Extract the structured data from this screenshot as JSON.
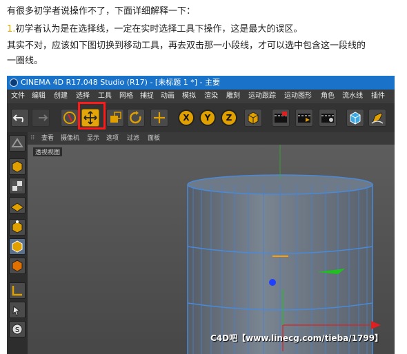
{
  "article": {
    "line1": "有很多初学者说操作不了，下面详细解释一下：",
    "line2_num": "1.",
    "line2": "初学者认为是在选择线，一定在实时选择工具下操作，这是最大的误区。",
    "line3": "其实不对，应该如下图切换到移动工具，再去双击那一小段线，才可以选中包含这一段线的",
    "line4": "一圈线。"
  },
  "app": {
    "title": "CINEMA 4D R17.048 Studio (R17) - [未标题 1 *] - 主要",
    "menu": [
      "文件",
      "编辑",
      "创建",
      "选择",
      "工具",
      "网格",
      "捕捉",
      "动画",
      "模拟",
      "渲染",
      "雕刻",
      "运动跟踪",
      "运动图形",
      "角色",
      "流水线",
      "插件"
    ],
    "axis_buttons": [
      "X",
      "Y",
      "Z"
    ],
    "viewport_menu": [
      "查看",
      "摄像机",
      "显示",
      "选项",
      "过滤",
      "面板"
    ],
    "viewport_label": "透视视图",
    "watermark": "C4D吧【www.linecg.com/tieba/1799】"
  },
  "colors": {
    "titlebar": "#1a73c8",
    "highlight": "#ff1a1a",
    "axis_x": "#e02020",
    "axis_y": "#20c020",
    "axis_z": "#2040ff",
    "accent": "#e0a000"
  },
  "icons": [
    "undo-icon",
    "redo-icon",
    "live-select-icon",
    "move-icon",
    "scale-icon",
    "rotate-icon",
    "last-tool-icon",
    "coord-icon",
    "render-icon",
    "cube-icon",
    "pen-icon"
  ]
}
